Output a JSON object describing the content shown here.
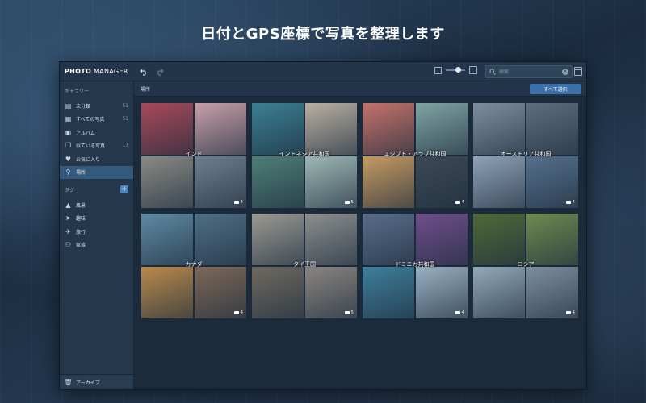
{
  "headline": "日付とGPS座標で写真を整理します",
  "app": {
    "brand_bold": "PHOTO",
    "brand_rest": " MANAGER"
  },
  "toolbar": {
    "undo_icon": "undo-icon",
    "redo_icon": "redo-icon",
    "zoom_level": 0.65
  },
  "search": {
    "placeholder": "検索"
  },
  "sidebar": {
    "gallery_header": "ギャラリー",
    "items": [
      {
        "label": "未分類",
        "count": "51",
        "icon": "inbox-icon"
      },
      {
        "label": "すべての写真",
        "count": "51",
        "icon": "photos-icon"
      },
      {
        "label": "アルバム",
        "count": "",
        "icon": "album-icon"
      },
      {
        "label": "似ている写真",
        "count": "17",
        "icon": "duplicate-icon"
      },
      {
        "label": "お気に入り",
        "count": "",
        "icon": "heart-icon"
      },
      {
        "label": "場所",
        "count": "",
        "icon": "pin-icon",
        "active": true
      }
    ],
    "tags_header": "タグ",
    "tags": [
      {
        "label": "風景",
        "icon": "landscape-icon"
      },
      {
        "label": "趣味",
        "icon": "paper-plane-icon"
      },
      {
        "label": "旅行",
        "icon": "travel-icon"
      },
      {
        "label": "家族",
        "icon": "family-icon"
      }
    ],
    "archive_label": "アーカイブ"
  },
  "content": {
    "title": "場所",
    "select_all": "すべて選択",
    "albums": [
      {
        "name": "インド",
        "count": "4",
        "tiles": [
          "#a8495a",
          "#c7a0a8",
          "#8a8a84",
          "#6f7f8f"
        ]
      },
      {
        "name": "インドネシア共和国",
        "count": "5",
        "tiles": [
          "#3c7f92",
          "#b9b0a2",
          "#4f7f76",
          "#9fb8b4"
        ]
      },
      {
        "name": "エジプト・アラブ共和国",
        "count": "4",
        "tiles": [
          "#c4726a",
          "#7fa4a3",
          "#c69a62",
          "#3c4a56"
        ]
      },
      {
        "name": "オーストリア共和国",
        "count": "4",
        "tiles": [
          "#7d8f9f",
          "#5d6e7e",
          "#8fa2b7",
          "#55708c"
        ]
      },
      {
        "name": "カナダ",
        "count": "4",
        "tiles": [
          "#5f8aa3",
          "#4f6f86",
          "#b98a4b",
          "#7d6858"
        ]
      },
      {
        "name": "タイ王国",
        "count": "5",
        "tiles": [
          "#9b9a92",
          "#8c8f8e",
          "#6f6a60",
          "#8a8580"
        ]
      },
      {
        "name": "ドミニカ共和国",
        "count": "4",
        "tiles": [
          "#5a6e8a",
          "#6f4f8a",
          "#3f7f9a",
          "#9ab1c2"
        ]
      },
      {
        "name": "ロシア",
        "count": "4",
        "tiles": [
          "#4f6a3a",
          "#6f8a4f",
          "#93a9b9",
          "#7c8fa0"
        ]
      }
    ]
  },
  "colors": {
    "accent": "#3c6fa8",
    "active_item": "#35587d",
    "window_bg": "#1f2f42"
  }
}
